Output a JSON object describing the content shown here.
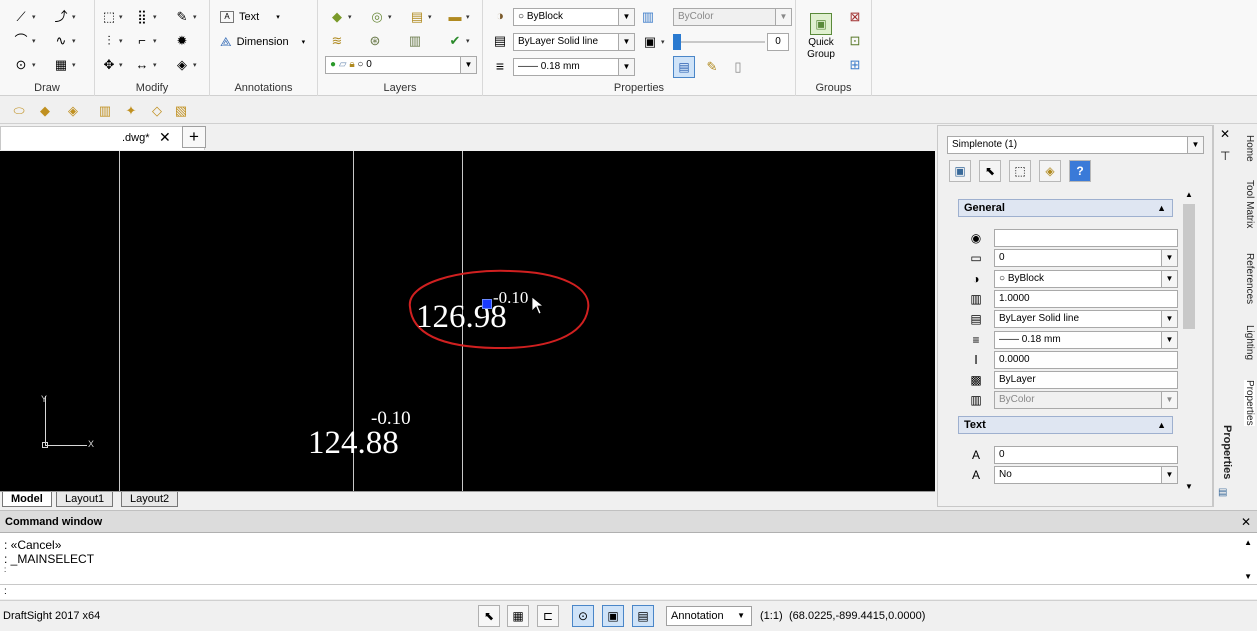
{
  "ribbon": {
    "groups": {
      "draw": "Draw",
      "modify": "Modify",
      "annotations": "Annotations",
      "layers": "Layers",
      "properties": "Properties",
      "groups": "Groups"
    },
    "annotations": {
      "text_label": "Text",
      "dimension_label": "Dimension"
    },
    "layers": {
      "layer_value": "0"
    },
    "properties": {
      "color_value": "ByBlock",
      "linestyle_value": "ByLayer    Solid line",
      "lineweight_value": "—— 0.18 mm",
      "transparency_mode": "ByColor",
      "transparency_value": "0",
      "transparency_level": 0
    },
    "groups_panel": {
      "quick_group_line1": "Quick",
      "quick_group_line2": "Group"
    }
  },
  "document": {
    "tab_name": ".dwg*",
    "close_symbol": "✕",
    "new_tab_symbol": "+"
  },
  "canvas": {
    "dim1_value": "126.98",
    "dim1_tolerance": "-0.10",
    "dim2_value": "124.88",
    "dim2_tolerance": "-0.10",
    "ucs_y": "Y",
    "ucs_x": "X"
  },
  "layout_tabs": [
    "Model",
    "Layout1",
    "Layout2"
  ],
  "properties_panel": {
    "selection": "Simplenote (1)",
    "general_header": "General",
    "text_header": "Text",
    "general_rows": [
      {
        "icon": "globe-icon",
        "value": ""
      },
      {
        "icon": "layer-icon",
        "value": "0"
      },
      {
        "icon": "color-icon",
        "value": "○ ByBlock"
      },
      {
        "icon": "linescale-icon",
        "value": "1.0000"
      },
      {
        "icon": "linestyle-icon",
        "value": "ByLayer    Solid line"
      },
      {
        "icon": "lineweight-icon",
        "value": "—— 0.18 mm"
      },
      {
        "icon": "thickness-icon",
        "value": "0.0000"
      },
      {
        "icon": "transparency-icon",
        "value": "ByLayer"
      },
      {
        "icon": "plotstyle-icon",
        "value": "ByColor"
      }
    ],
    "text_rows": [
      {
        "icon": "text-content-icon",
        "value": "0"
      },
      {
        "icon": "annotative-icon",
        "value": "No"
      }
    ],
    "side_tabs": [
      "Home",
      "Tool Matrix",
      "References",
      "Lighting",
      "Properties"
    ],
    "side_title": "Properties"
  },
  "command_window": {
    "title": "Command window",
    "lines": [
      ": «Cancel»",
      ": _MAINSELECT",
      ":"
    ],
    "prompt": ":"
  },
  "statusbar": {
    "app_name": "DraftSight 2017 x64",
    "annotation": "Annotation",
    "scale": "(1:1)",
    "coords": "(68.0225,-899.4415,0.0000)"
  }
}
